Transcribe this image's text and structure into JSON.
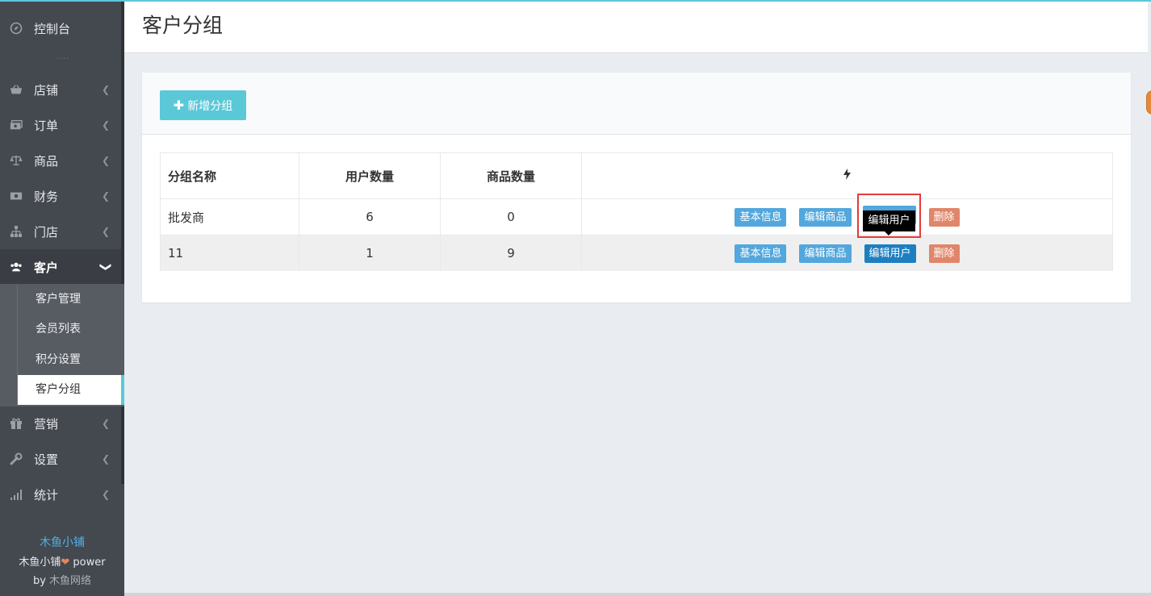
{
  "sidebar": {
    "items": [
      {
        "label": "控制台",
        "icon": "compass-icon"
      },
      {
        "label": "店铺",
        "icon": "basket-icon"
      },
      {
        "label": "订单",
        "icon": "money-icon"
      },
      {
        "label": "商品",
        "icon": "scale-icon"
      },
      {
        "label": "财务",
        "icon": "cash-icon"
      },
      {
        "label": "门店",
        "icon": "sitemap-icon"
      },
      {
        "label": "客户",
        "icon": "users-icon"
      },
      {
        "label": "营销",
        "icon": "gift-icon"
      },
      {
        "label": "设置",
        "icon": "wrench-icon"
      },
      {
        "label": "统计",
        "icon": "signal-icon"
      }
    ],
    "sub_items": [
      {
        "label": "客户管理"
      },
      {
        "label": "会员列表"
      },
      {
        "label": "积分设置"
      },
      {
        "label": "客户分组"
      }
    ],
    "footer": {
      "brand": "木鱼小铺",
      "power_prefix": "木鱼小铺",
      "power_suffix": " power",
      "by_prefix": "by ",
      "by_name": "木鱼网络"
    }
  },
  "header": {
    "title": "客户分组"
  },
  "toolbar": {
    "add_label": "新增分组"
  },
  "table": {
    "headers": [
      "分组名称",
      "用户数量",
      "商品数量",
      "⚡"
    ],
    "rows": [
      {
        "name": "批发商",
        "users": "6",
        "goods": "0"
      },
      {
        "name": "11",
        "users": "1",
        "goods": "9"
      }
    ],
    "actions": {
      "info": "基本信息",
      "goods": "编辑商品",
      "users": "编辑用户",
      "delete": "删除"
    }
  },
  "tooltip": {
    "text": "编辑用户"
  },
  "colors": {
    "accent": "#5bc8d8",
    "sidebar_bg": "#44484f",
    "info_btn": "#52a7dc",
    "delete_btn": "#e0866a",
    "highlight": "#e33b3b"
  }
}
